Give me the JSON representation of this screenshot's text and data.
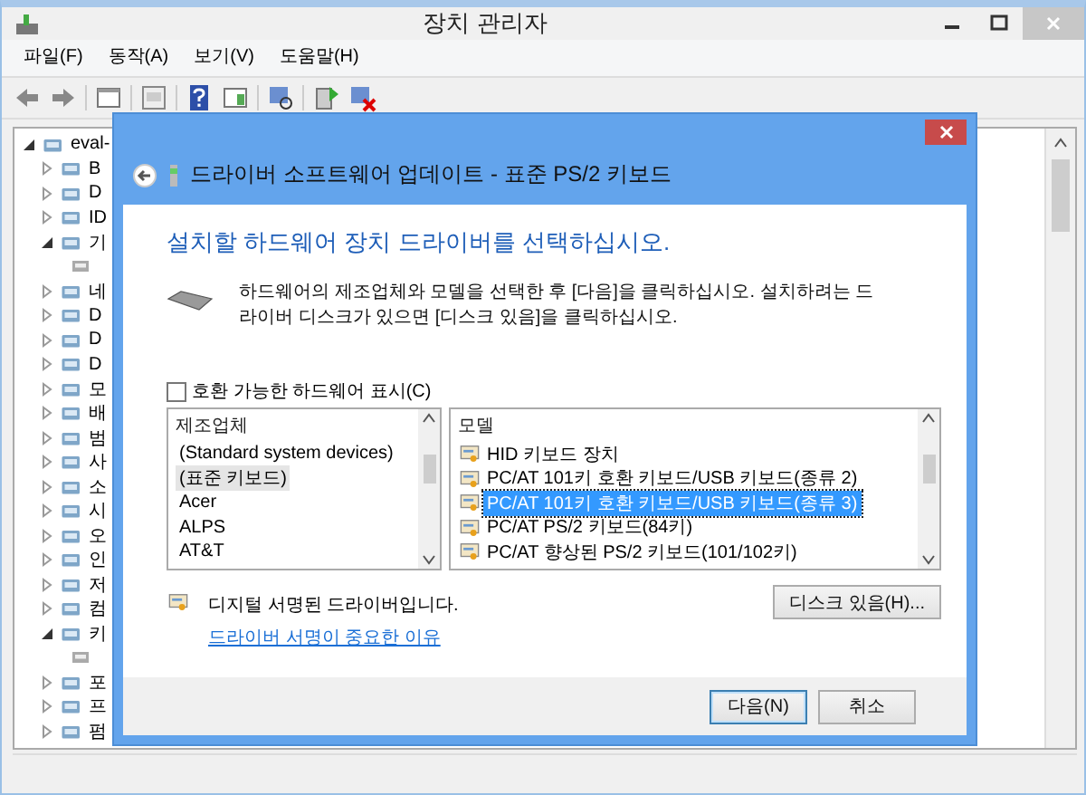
{
  "window": {
    "title": "장치 관리자"
  },
  "menu": [
    "파일(F)",
    "동작(A)",
    "보기(V)",
    "도움말(H)"
  ],
  "tree": {
    "label": "eval-",
    "expanded": true,
    "children": [
      {
        "label": "B",
        "expanded": false
      },
      {
        "label": "D",
        "expanded": false
      },
      {
        "label": "ID",
        "expanded": false
      },
      {
        "label": "기",
        "expanded": true,
        "children": [
          {
            "kind": "device"
          }
        ]
      },
      {
        "label": "네",
        "expanded": false
      },
      {
        "label": "D",
        "expanded": false
      },
      {
        "label": "D",
        "expanded": false
      },
      {
        "label": "D",
        "expanded": false
      },
      {
        "label": "모",
        "expanded": false
      },
      {
        "label": "배",
        "expanded": false
      },
      {
        "label": "범",
        "expanded": false
      },
      {
        "label": "사",
        "expanded": false
      },
      {
        "label": "소",
        "expanded": false
      },
      {
        "label": "시",
        "expanded": false
      },
      {
        "label": "오",
        "expanded": false
      },
      {
        "label": "인",
        "expanded": false
      },
      {
        "label": "저",
        "expanded": false
      },
      {
        "label": "컴",
        "expanded": false
      },
      {
        "label": "키",
        "expanded": true,
        "children": [
          {
            "kind": "device"
          }
        ]
      },
      {
        "label": "포",
        "expanded": false
      },
      {
        "label": "프",
        "expanded": false
      },
      {
        "label": "펌",
        "expanded": false
      }
    ]
  },
  "dialog": {
    "title": "드라이버 소프트웨어 업데이트 - 표준 PS/2 키보드",
    "heading": "설치할 하드웨어 장치 드라이버를 선택하십시오.",
    "description": "하드웨어의 제조업체와 모델을 선택한 후 [다음]을 클릭하십시오. 설치하려는 드라이버 디스크가 있으면 [디스크 있음]을 클릭하십시오.",
    "compatible_checkbox": {
      "label": "호환 가능한 하드웨어 표시(C)",
      "checked": false
    },
    "manufacturers": {
      "header": "제조업체",
      "items": [
        {
          "label": "(Standard system devices)",
          "selected": false
        },
        {
          "label": "(표준 키보드)",
          "selected": true
        },
        {
          "label": "Acer",
          "selected": false
        },
        {
          "label": "ALPS",
          "selected": false
        },
        {
          "label": "AT&T",
          "selected": false
        }
      ]
    },
    "models": {
      "header": "모델",
      "items": [
        {
          "label": "HID 키보드 장치",
          "selected": false
        },
        {
          "label": "PC/AT 101키 호환 키보드/USB 키보드(종류 2)",
          "selected": false
        },
        {
          "label": "PC/AT 101키 호환 키보드/USB 키보드(종류 3)",
          "selected": true
        },
        {
          "label": "PC/AT PS/2 키보드(84키)",
          "selected": false
        },
        {
          "label": "PC/AT 향상된 PS/2 키보드(101/102키)",
          "selected": false
        }
      ]
    },
    "signed_text": "디지털 서명된 드라이버입니다.",
    "signing_link": "드라이버 서명이 중요한 이유",
    "have_disk_button": "디스크 있음(H)...",
    "next_button": "다음(N)",
    "cancel_button": "취소"
  }
}
